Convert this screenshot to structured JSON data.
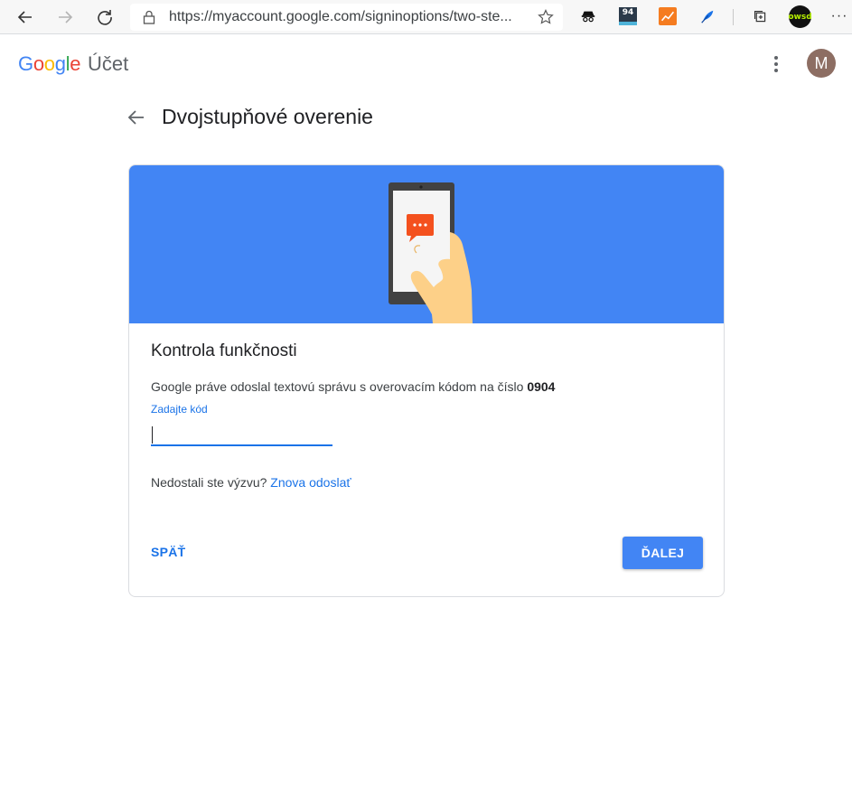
{
  "browser": {
    "url": "https://myaccount.google.com/signinoptions/two-ste...",
    "extension_badge_94": "94",
    "profile_badge": "owsd"
  },
  "header": {
    "logo_letters": [
      "G",
      "o",
      "o",
      "g",
      "l",
      "e"
    ],
    "logo_colors": [
      "#4285f4",
      "#ea4335",
      "#fbbc05",
      "#4285f4",
      "#34a853",
      "#ea4335"
    ],
    "product": "Účet",
    "avatar_initial": "M"
  },
  "page": {
    "title": "Dvojstupňové overenie"
  },
  "card": {
    "title": "Kontrola funkčnosti",
    "description": "Google práve odoslal textovú správu s overovacím kódom na číslo",
    "phone_suffix": "0904",
    "field_label": "Zadajte kód",
    "field_value": "",
    "resend_prompt": "Nedostali ste výzvu?",
    "resend_link": "Znova odoslať",
    "back_label": "SPÄŤ",
    "next_label": "ĎALEJ"
  },
  "colors": {
    "banner": "#4285f4",
    "accent": "#1a73e8",
    "button": "#4285f4"
  }
}
